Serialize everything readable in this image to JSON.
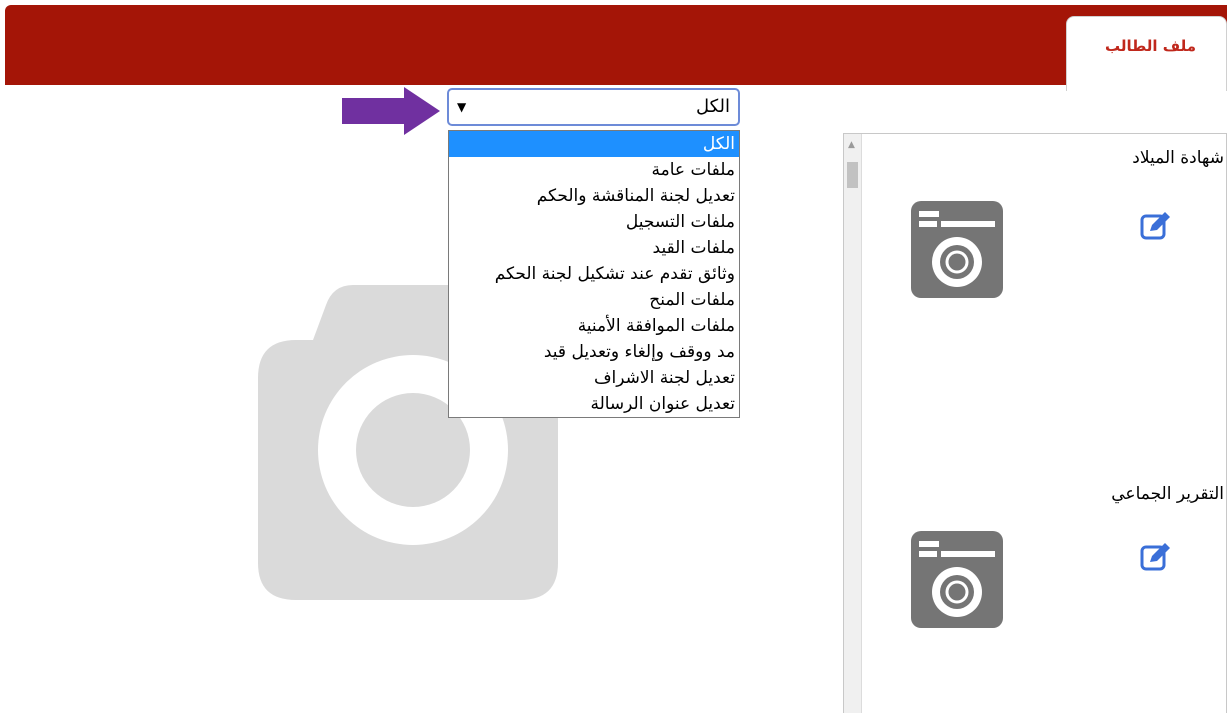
{
  "header": {
    "active_tab": "ملف الطالب",
    "bar_color": "#a41507"
  },
  "filter": {
    "selected": "الكل",
    "options": [
      "الكل",
      "ملفات عامة",
      "تعديل لجنة المناقشة والحكم",
      "ملفات التسجيل",
      "ملفات القيد",
      "وثائق تقدم عند تشكيل لجنة الحكم",
      "ملفات المنح",
      "ملفات الموافقة الأمنية",
      "مد ووقف وإلغاء وتعديل قيد",
      "تعديل لجنة الاشراف",
      "تعديل عنوان الرسالة"
    ],
    "highlight_color": "#1e90ff"
  },
  "documents": [
    {
      "title": "شهادة الميلاد",
      "thumbnail_icon": "camera-icon",
      "action_icon": "edit-icon"
    },
    {
      "title": "التقرير الجماعي",
      "thumbnail_icon": "camera-icon",
      "action_icon": "edit-icon"
    }
  ],
  "placeholder_icon": "camera-icon",
  "annotation": {
    "arrow_icon": "arrow-right-icon",
    "color": "#7030a0"
  }
}
